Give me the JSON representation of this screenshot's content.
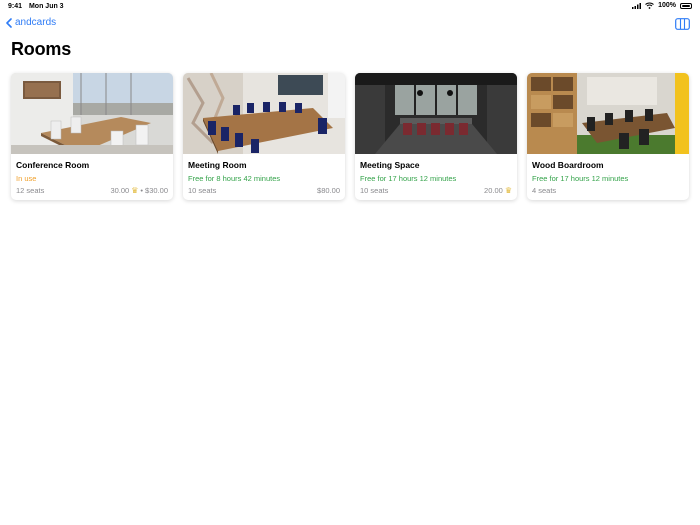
{
  "status_bar": {
    "time": "9:41",
    "date": "Mon Jun 3",
    "battery": "100%"
  },
  "nav": {
    "back_label": "andcards"
  },
  "page": {
    "title": "Rooms"
  },
  "colors": {
    "accent": "#2f7cf6",
    "in_use": "#f0a02b",
    "free": "#34a34a"
  },
  "rooms": [
    {
      "name": "Conference Room",
      "status": "In use",
      "status_type": "in_use",
      "seats": "12 seats",
      "credits": "30.00",
      "separator": "•",
      "price": "$30.00"
    },
    {
      "name": "Meeting Room",
      "status": "Free for 8 hours 42 minutes",
      "status_type": "free",
      "seats": "10 seats",
      "credits": "",
      "separator": "",
      "price": "$80.00"
    },
    {
      "name": "Meeting Space",
      "status": "Free for 17 hours 12 minutes",
      "status_type": "free",
      "seats": "10 seats",
      "credits": "20.00",
      "separator": "",
      "price": ""
    },
    {
      "name": "Wood Boardroom",
      "status": "Free for 17 hours 12 minutes",
      "status_type": "free",
      "seats": "4 seats",
      "credits": "",
      "separator": "",
      "price": ""
    }
  ]
}
